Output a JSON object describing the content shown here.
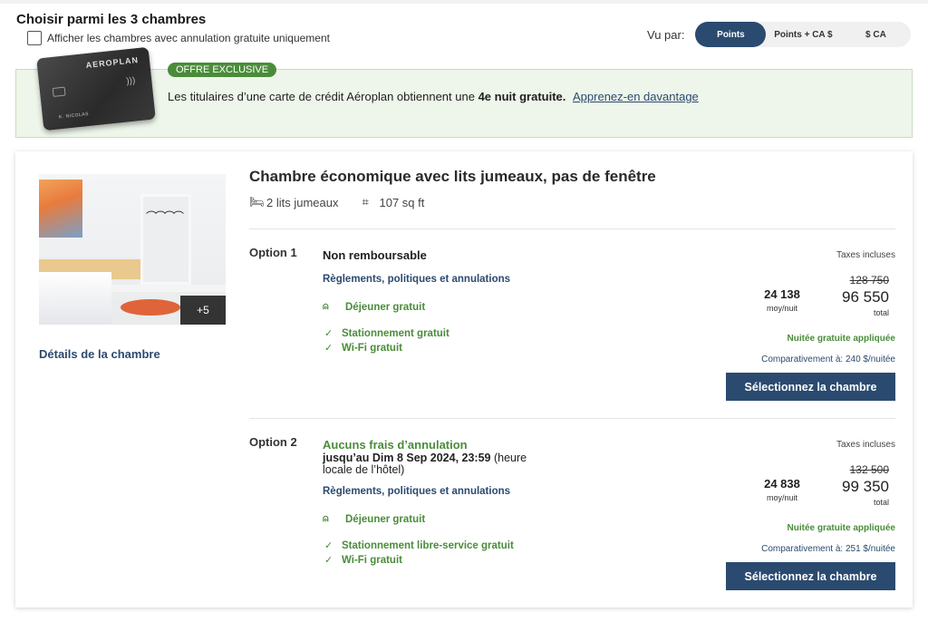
{
  "header": {
    "title": "Choisir parmi les 3 chambres",
    "filter_label": "Afficher les chambres avec annulation gratuite uniquement",
    "viewby_label": "Vu par:",
    "toggle": [
      {
        "label": "Points",
        "active": true
      },
      {
        "label": "Points + CA $",
        "active": false
      },
      {
        "label": "$ CA",
        "active": false
      }
    ]
  },
  "promo": {
    "badge": "OFFRE EXCLUSIVE",
    "text_before": "Les titulaires d’une carte de crédit Aéroplan obtiennent une ",
    "text_bold": "4e nuit gratuite.",
    "link": "Apprenez-en davantage",
    "card_brand": "AEROPLAN",
    "card_name": "K. NICOLAS"
  },
  "room": {
    "title": "Chambre économique avec lits jumeaux, pas de fenêtre",
    "beds": "2 lits jumeaux",
    "size": "107 sq ft",
    "photo_more": "+5",
    "details_link": "Détails de la chambre",
    "options": [
      {
        "label": "Option 1",
        "heading": "Non remboursable",
        "policy_link": "Règlements, politiques et annulations",
        "breakfast": "Déjeuner gratuit",
        "amenities": [
          "Stationnement gratuit",
          "Wi-Fi gratuit"
        ],
        "taxes": "Taxes incluses",
        "per_night": "24 138",
        "per_night_unit": "moy/nuit",
        "old_total": "128 750",
        "total": "96 550",
        "total_label": "total",
        "free_night": "Nuitée gratuite appliquée",
        "compare": "Comparativement à: 240 $/nuitée",
        "button": "Sélectionnez la chambre"
      },
      {
        "label": "Option 2",
        "heading": "Aucuns frais d’annulation",
        "cancel_bold": "jusqu’au Dim 8 Sep 2024, 23:59",
        "cancel_rest": " (heure locale de l’hôtel)",
        "policy_link": "Règlements, politiques et annulations",
        "breakfast": "Déjeuner gratuit",
        "amenities": [
          "Stationnement libre-service gratuit",
          "Wi-Fi gratuit"
        ],
        "taxes": "Taxes incluses",
        "per_night": "24 838",
        "per_night_unit": "moy/nuit",
        "old_total": "132 500",
        "total": "99 350",
        "total_label": "total",
        "free_night": "Nuitée gratuite appliquée",
        "compare": "Comparativement à: 251 $/nuitée",
        "button": "Sélectionnez la chambre"
      }
    ]
  },
  "colors": {
    "primary": "#2b4a6f",
    "green": "#4a8c3a",
    "promo_bg": "#eef5ea"
  }
}
